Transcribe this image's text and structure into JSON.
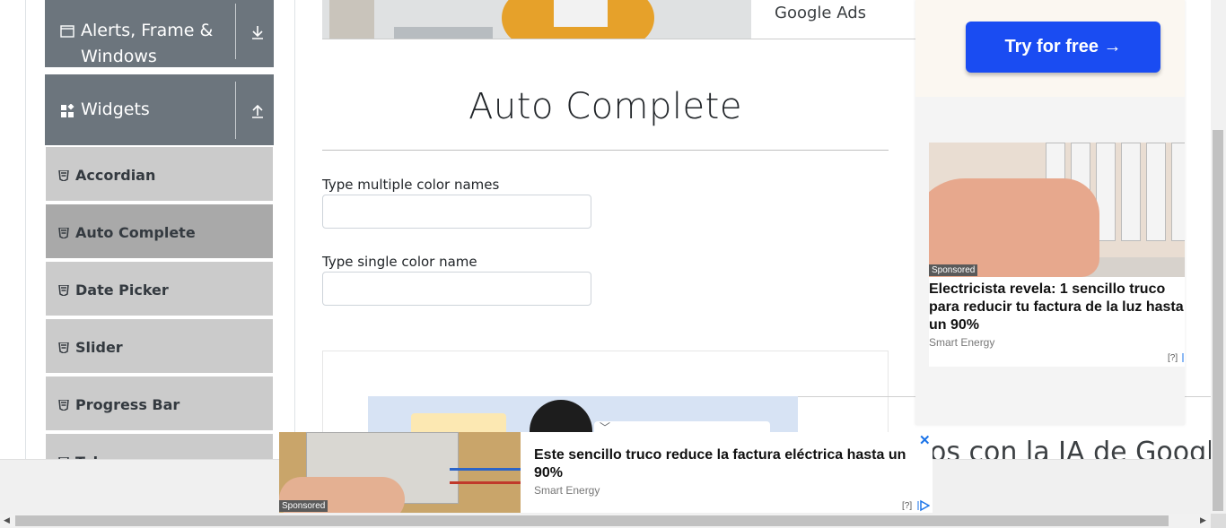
{
  "sidebar": {
    "groups": [
      {
        "title_line1": "Alerts, Frame &",
        "title_line2": "Windows",
        "icon": "window-icon",
        "toggle_icon": "download-arrow-icon"
      },
      {
        "title": "Widgets",
        "icon": "widgets-icon",
        "toggle_icon": "upload-arrow-icon"
      }
    ],
    "items": [
      {
        "label": "Accordian"
      },
      {
        "label": "Auto Complete",
        "active": true
      },
      {
        "label": "Date Picker"
      },
      {
        "label": "Slider"
      },
      {
        "label": "Progress Bar"
      },
      {
        "label": "Tabs"
      }
    ]
  },
  "banner": {
    "text": "Google Ads"
  },
  "main": {
    "title": "Auto Complete",
    "multiple_label": "Type multiple color names",
    "multiple_value": "",
    "single_label": "Type single color name",
    "single_value": ""
  },
  "ad_strip": {
    "text": "os con la IA de Google"
  },
  "right_ad": {
    "cta": "Try for free →",
    "sponsored": "Sponsored",
    "headline": "Electricista revela: 1 sencillo truco para reducir tu factura de la luz hasta un 90%",
    "source": "Smart Energy",
    "adchoice": "[?]",
    "close": "✕"
  },
  "bottom_ad": {
    "sponsored": "Sponsored",
    "headline": "Este sencillo truco reduce la factura eléctrica hasta un 90%",
    "source": "Smart Energy",
    "adchoice": "[?]",
    "close": "✕"
  },
  "colors": {
    "sidebar_group": "#6c757d",
    "sidebar_item": "#cbcbcb",
    "sidebar_item_active": "#a9a9a9",
    "cta": "#1a4cf2",
    "ad_close": "#1a73e8"
  }
}
